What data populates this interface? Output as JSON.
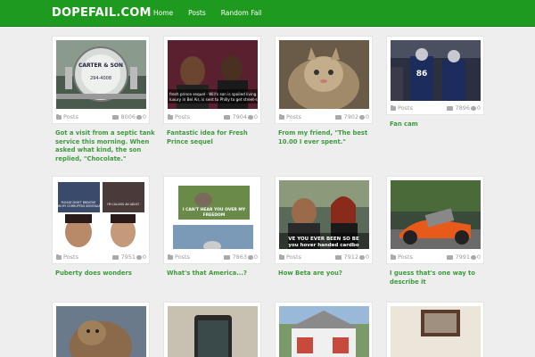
{
  "site": {
    "logo": "DOPEFAIL.COM",
    "nav": [
      "Home",
      "Posts",
      "Random Fail"
    ],
    "brand_color": "#1e9a1e",
    "link_color": "#3c9a3c"
  },
  "posts": [
    {
      "category": "Posts",
      "views": "8006",
      "comments": "0",
      "title": "Got a visit from a septic tank service this morning. When asked what kind, the son replied, \"Chocolate.\"",
      "thumb_text": "CARTER & SON"
    },
    {
      "category": "Posts",
      "views": "7904",
      "comments": "0",
      "title": "Fantastic idea for Fresh Prince sequel",
      "thumb_text": "fresh prince sequel - Will's son is spoiled living in a luxury in Bel Air, is sent to Philly to get street-smart"
    },
    {
      "category": "Posts",
      "views": "7902",
      "comments": "0",
      "title": "From my friend, \"The best 10.00 I ever spent.\"",
      "thumb_text": ""
    },
    {
      "category": "Posts",
      "views": "7896",
      "comments": "0",
      "title": "Fan cam",
      "thumb_text": "86"
    },
    {
      "category": "Posts",
      "views": "7951",
      "comments": "0",
      "title": "Puberty does wonders",
      "thumb_text": "PLEASE DON'T BREATHE ON MY CORRUPTED GENITALIA"
    },
    {
      "category": "Posts",
      "views": "7863",
      "comments": "0",
      "title": "What's that America...?",
      "thumb_text": "I CAN'T HEAR YOU OVER MY FREEDOM"
    },
    {
      "category": "Posts",
      "views": "7912",
      "comments": "0",
      "title": "How Beta are you?",
      "thumb_text": "VE YOU EVER BEEN SO BE you hover handed cardbo"
    },
    {
      "category": "Posts",
      "views": "7991",
      "comments": "0",
      "title": "I guess that's one way to describe it",
      "thumb_text": ""
    },
    {
      "category": "",
      "views": "",
      "comments": "",
      "title": "",
      "thumb_text": ""
    },
    {
      "category": "",
      "views": "",
      "comments": "",
      "title": "",
      "thumb_text": ""
    },
    {
      "category": "",
      "views": "",
      "comments": "",
      "title": "",
      "thumb_text": ""
    },
    {
      "category": "",
      "views": "",
      "comments": "",
      "title": "",
      "thumb_text": ""
    }
  ]
}
